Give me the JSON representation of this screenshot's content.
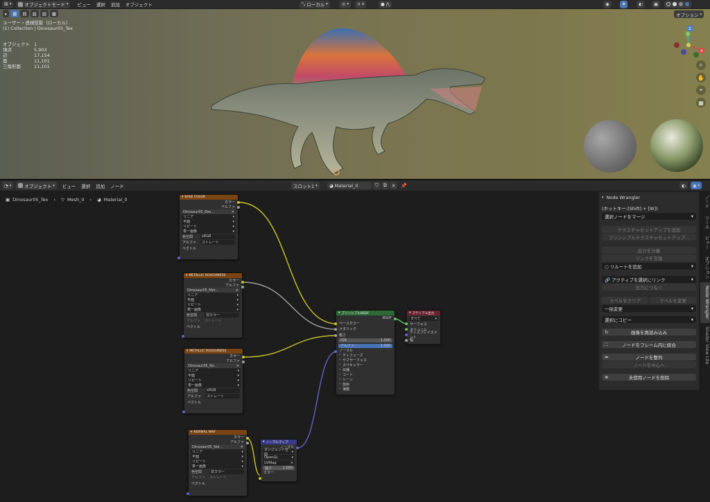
{
  "top_header": {
    "mode": "オブジェクトモード",
    "menus": [
      "ビュー",
      "選択",
      "追加",
      "オブジェクト"
    ],
    "transform_orientation": "ローカル",
    "options_label": "オプション"
  },
  "viewport": {
    "view_name": "ユーザー・透視投影（ローカル）",
    "collection_path": "(1) Collection | Dinosaur05_Tex",
    "stats": [
      {
        "label": "オブジェクト",
        "value": "1"
      },
      {
        "label": "頂点",
        "value": "5,903"
      },
      {
        "label": "辺",
        "value": "17,154"
      },
      {
        "label": "面",
        "value": "11,101"
      },
      {
        "label": "三角形面",
        "value": "11,101"
      }
    ],
    "gizmo": {
      "z": "Z",
      "y": "Y",
      "x": "X"
    }
  },
  "node_editor_header": {
    "editor_type": "オブジェクト",
    "menus": [
      "ビュー",
      "選択",
      "追加",
      "ノード"
    ],
    "slot": "スロット1",
    "material": "Material_0"
  },
  "breadcrumb": {
    "object": "Dinosaur05_Tex",
    "mesh": "Mesh_0",
    "material": "Material_0"
  },
  "nodes": {
    "tex1": {
      "title": "BASE COLOR",
      "out_color": "カラー",
      "out_alpha": "アルファ",
      "image": "Dinosaur05_Bas...",
      "interp": "リニア",
      "proj": "平面",
      "ext": "リピート",
      "frame": "単一画像",
      "cs_label": "色空間",
      "cs_value": "sRGB",
      "alpha_label": "アルファ",
      "alpha_value": "ストレート",
      "vector": "ベクトル"
    },
    "tex2": {
      "title": "METALLIC ROUGHNESS",
      "out_color": "カラー",
      "out_alpha": "アルファ",
      "image": "Dinosaur05_Met...",
      "interp": "リニア",
      "proj": "平面",
      "ext": "リピート",
      "frame": "単一画像",
      "cs_label": "色空間",
      "cs_value": "非カラー",
      "alpha_label": "アルファ",
      "alpha_value": "ストレート",
      "vector": "ベクトル"
    },
    "tex3": {
      "title": "METALLIC ROUGHNESS",
      "out_color": "カラー",
      "out_alpha": "アルファ",
      "image": "Dinosaur05_Ro...",
      "interp": "リニア",
      "proj": "平面",
      "ext": "リピート",
      "frame": "単一画像",
      "cs_label": "色空間",
      "cs_value": "sRGB",
      "alpha_label": "アルファ",
      "alpha_value": "ストレート",
      "vector": "ベクトル"
    },
    "tex4": {
      "title": "NORMAL MAP",
      "out_color": "カラー",
      "out_alpha": "アルファ",
      "image": "Dinosaur05_Nor...",
      "interp": "リニア",
      "proj": "平面",
      "ext": "リピート",
      "frame": "単一画像",
      "cs_label": "色空間",
      "cs_value": "非カラー",
      "alpha_label": "アルファ",
      "alpha_value": "ストレート",
      "vector": "ベクトル"
    },
    "bsdf": {
      "title": "プリンシプルBSDF",
      "out": "BSDF",
      "base_color": "ベースカラー",
      "metallic": "メタリック",
      "roughness": "粗さ",
      "ior_label": "IOR",
      "ior_value": "1.500",
      "alpha_label": "アルファ",
      "alpha_value": "1.000",
      "normal": "ノーマル",
      "panels": [
        "ディフューズ",
        "サブサーフェス",
        "スペキュラー",
        "伝播",
        "コート",
        "シーン",
        "放射",
        "薄膜"
      ]
    },
    "output": {
      "title": "マテリアル出力",
      "target": "すべて",
      "surface": "サーフェス",
      "volume": "ボリューム",
      "displacement": "ディスプレイスメント",
      "thickness": "幅"
    },
    "normalmap": {
      "title": "ノーマルマップ",
      "out": "ノーマル",
      "space": "タンジェント空間",
      "convention": "OpenGL",
      "uv": "UVMap",
      "strength_label": "強さ",
      "strength_value": "1.000",
      "color": "カラー"
    }
  },
  "nw_panel": {
    "title": "Node Wrangler",
    "hotkey": "(ホットキー:[Shift] + [W])",
    "merge": "選択ノードをマージ",
    "tex_setup": "テクスチャセットアップを追加",
    "principled_setup": "プリンシプルテクスチャセットアップ...",
    "split_output": "出力を分離",
    "swap_links": "リンクを交換",
    "add_reroute": "リルートを追加",
    "link_active": "アクティブを選択にリンク",
    "connect_output": "出力につなぐ",
    "clear_label": "ラベルをクリア",
    "modify_label": "ラベルを変更",
    "batch_change": "一括変更",
    "copy_to_selected": "選択にコピー",
    "reload_images": "画像を再読み込み",
    "frame_nodes": "ノードをフレーム内に統合",
    "align_nodes": "ノードを整列",
    "center_nodes": "ノードを中心へ",
    "delete_unused": "未使用ノードを削除"
  },
  "side_tabs": [
    "ノード",
    "ツール",
    "ビュー",
    "オプション",
    "Node Wrangler",
    "Shader View Lite"
  ],
  "colors": {
    "link_yellow": "#c7c729",
    "link_grey": "#a1a1a1",
    "link_violet": "#6363c7",
    "texture_header": "#7a4512",
    "shader_header": "#2d6a35",
    "output_header": "#6b2230"
  }
}
